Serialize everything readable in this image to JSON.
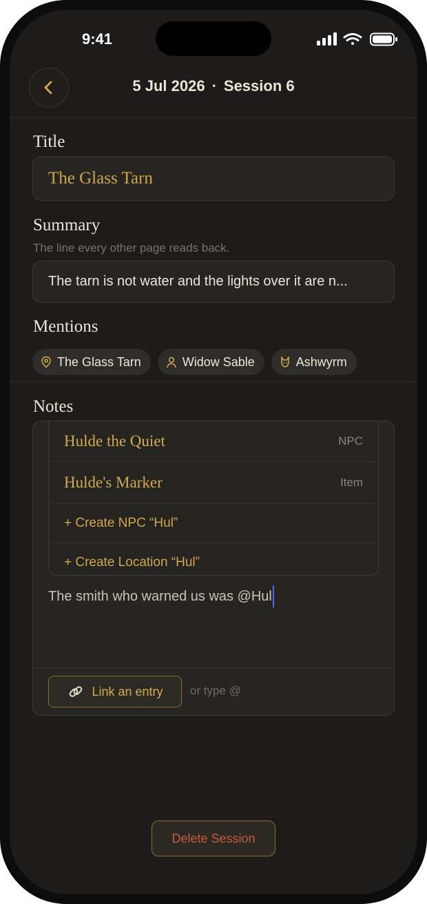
{
  "status_bar": {
    "time": "9:41"
  },
  "nav": {
    "date": "5 Jul 2026",
    "separator": "·",
    "session": "Session 6"
  },
  "title_section": {
    "label": "Title",
    "value": "The Glass Tarn"
  },
  "summary_section": {
    "label": "Summary",
    "hint": "The line every other page reads back.",
    "value": "The tarn is not water and the lights over it are n..."
  },
  "mentions": {
    "label": "Mentions",
    "items": [
      {
        "label": "The Glass Tarn",
        "icon": "location-pin-icon"
      },
      {
        "label": "Widow Sable",
        "icon": "person-icon"
      },
      {
        "label": "Ashwyrm",
        "icon": "creature-icon"
      }
    ]
  },
  "notes": {
    "label": "Notes",
    "suggestions": [
      {
        "name": "Hulde the Quiet",
        "type": "NPC"
      },
      {
        "name": "Hulde's Marker",
        "type": "Item"
      }
    ],
    "create_options": [
      {
        "label": "+ Create NPC “Hul”"
      },
      {
        "label": "+ Create Location “Hul”"
      }
    ],
    "text": "The smith who warned us was @Hul",
    "link_button": "Link an entry",
    "or_type_hint": "or type @"
  },
  "delete_button": "Delete Session",
  "colors": {
    "background": "#1d1c1a",
    "accent_gold": "#cfa64a",
    "text_primary": "#ece6d8",
    "danger": "#c85a40",
    "caret": "#4a6cf0"
  }
}
